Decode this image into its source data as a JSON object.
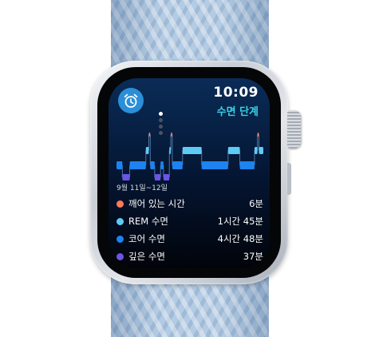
{
  "status": {
    "time": "10:09"
  },
  "app": {
    "title": "수면 단계",
    "icon": "alarm-clock-icon"
  },
  "pager": {
    "count": 4,
    "active": 0
  },
  "sleep": {
    "date_range": "9월 11일~12일",
    "stages": [
      {
        "key": "awake",
        "label": "깨어 있는 시간",
        "duration": "6분",
        "color": "#ff7a5c"
      },
      {
        "key": "rem",
        "label": "REM 수면",
        "duration": "1시간 45분",
        "color": "#5ecbf5"
      },
      {
        "key": "core",
        "label": "코어 수면",
        "duration": "4시간 48분",
        "color": "#1d83f0"
      },
      {
        "key": "deep",
        "label": "깊은 수면",
        "duration": "37분",
        "color": "#6b55e6"
      }
    ]
  },
  "chart_data": {
    "type": "hypnogram",
    "levels": [
      "awake",
      "rem",
      "core",
      "deep"
    ],
    "segments": [
      {
        "stage": "core",
        "start": 0.0,
        "end": 0.04
      },
      {
        "stage": "deep",
        "start": 0.04,
        "end": 0.09
      },
      {
        "stage": "core",
        "start": 0.09,
        "end": 0.2
      },
      {
        "stage": "rem",
        "start": 0.2,
        "end": 0.22
      },
      {
        "stage": "awake",
        "start": 0.22,
        "end": 0.23
      },
      {
        "stage": "core",
        "start": 0.23,
        "end": 0.26
      },
      {
        "stage": "deep",
        "start": 0.26,
        "end": 0.3
      },
      {
        "stage": "core",
        "start": 0.3,
        "end": 0.32
      },
      {
        "stage": "deep",
        "start": 0.32,
        "end": 0.36
      },
      {
        "stage": "rem",
        "start": 0.36,
        "end": 0.37
      },
      {
        "stage": "awake",
        "start": 0.37,
        "end": 0.38
      },
      {
        "stage": "core",
        "start": 0.38,
        "end": 0.45
      },
      {
        "stage": "rem",
        "start": 0.45,
        "end": 0.58
      },
      {
        "stage": "core",
        "start": 0.58,
        "end": 0.76
      },
      {
        "stage": "rem",
        "start": 0.76,
        "end": 0.84
      },
      {
        "stage": "core",
        "start": 0.84,
        "end": 0.94
      },
      {
        "stage": "rem",
        "start": 0.94,
        "end": 0.96
      },
      {
        "stage": "awake",
        "start": 0.96,
        "end": 0.97
      },
      {
        "stage": "rem",
        "start": 0.97,
        "end": 1.0
      }
    ]
  }
}
